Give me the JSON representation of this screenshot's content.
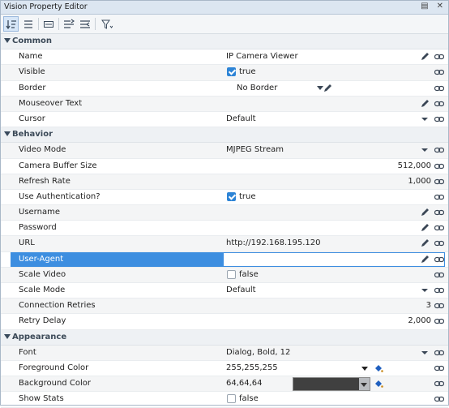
{
  "window": {
    "title": "Vision Property Editor"
  },
  "toolbar": {
    "buttons": [
      "sort-categorized",
      "show-all",
      "customizer",
      "align-left",
      "align-right",
      "filter"
    ]
  },
  "categories": [
    {
      "name": "Common",
      "props": [
        {
          "label": "Name",
          "value": "IP Camera Viewer",
          "type": "text",
          "edit": true
        },
        {
          "label": "Visible",
          "value": "true",
          "type": "check",
          "checked": true
        },
        {
          "label": "Border",
          "value": "No Border",
          "type": "border"
        },
        {
          "label": "Mouseover Text",
          "value": "",
          "type": "text",
          "edit": true
        },
        {
          "label": "Cursor",
          "value": "Default",
          "type": "dropdown"
        }
      ]
    },
    {
      "name": "Behavior",
      "props": [
        {
          "label": "Video Mode",
          "value": "MJPEG Stream",
          "type": "dropdown"
        },
        {
          "label": "Camera Buffer Size",
          "value": "512,000",
          "type": "number"
        },
        {
          "label": "Refresh Rate",
          "value": "1,000",
          "type": "number"
        },
        {
          "label": "Use Authentication?",
          "value": "true",
          "type": "check",
          "checked": true
        },
        {
          "label": "Username",
          "value": "",
          "type": "text",
          "edit": true
        },
        {
          "label": "Password",
          "value": "",
          "type": "text",
          "edit": true
        },
        {
          "label": "URL",
          "value": "http://192.168.195.120",
          "type": "text",
          "edit": true
        },
        {
          "label": "User-Agent",
          "value": "",
          "type": "text",
          "edit": true,
          "selected": true
        },
        {
          "label": "Scale Video",
          "value": "false",
          "type": "check",
          "checked": false
        },
        {
          "label": "Scale Mode",
          "value": "Default",
          "type": "dropdown"
        },
        {
          "label": "Connection Retries",
          "value": "3",
          "type": "number"
        },
        {
          "label": "Retry Delay",
          "value": "2,000",
          "type": "number"
        }
      ]
    },
    {
      "name": "Appearance",
      "props": [
        {
          "label": "Font",
          "value": "Dialog, Bold, 12",
          "type": "dropdown"
        },
        {
          "label": "Foreground Color",
          "value": "255,255,255",
          "type": "color",
          "swatch": ""
        },
        {
          "label": "Background Color",
          "value": "64,64,64",
          "type": "color",
          "swatch": "#404040"
        },
        {
          "label": "Show Stats",
          "value": "false",
          "type": "check",
          "checked": false
        }
      ]
    }
  ],
  "colors": {
    "selection": "#3d8ee0",
    "category_bg": "#eef1f4",
    "checkbox_on": "#2d84d6"
  }
}
